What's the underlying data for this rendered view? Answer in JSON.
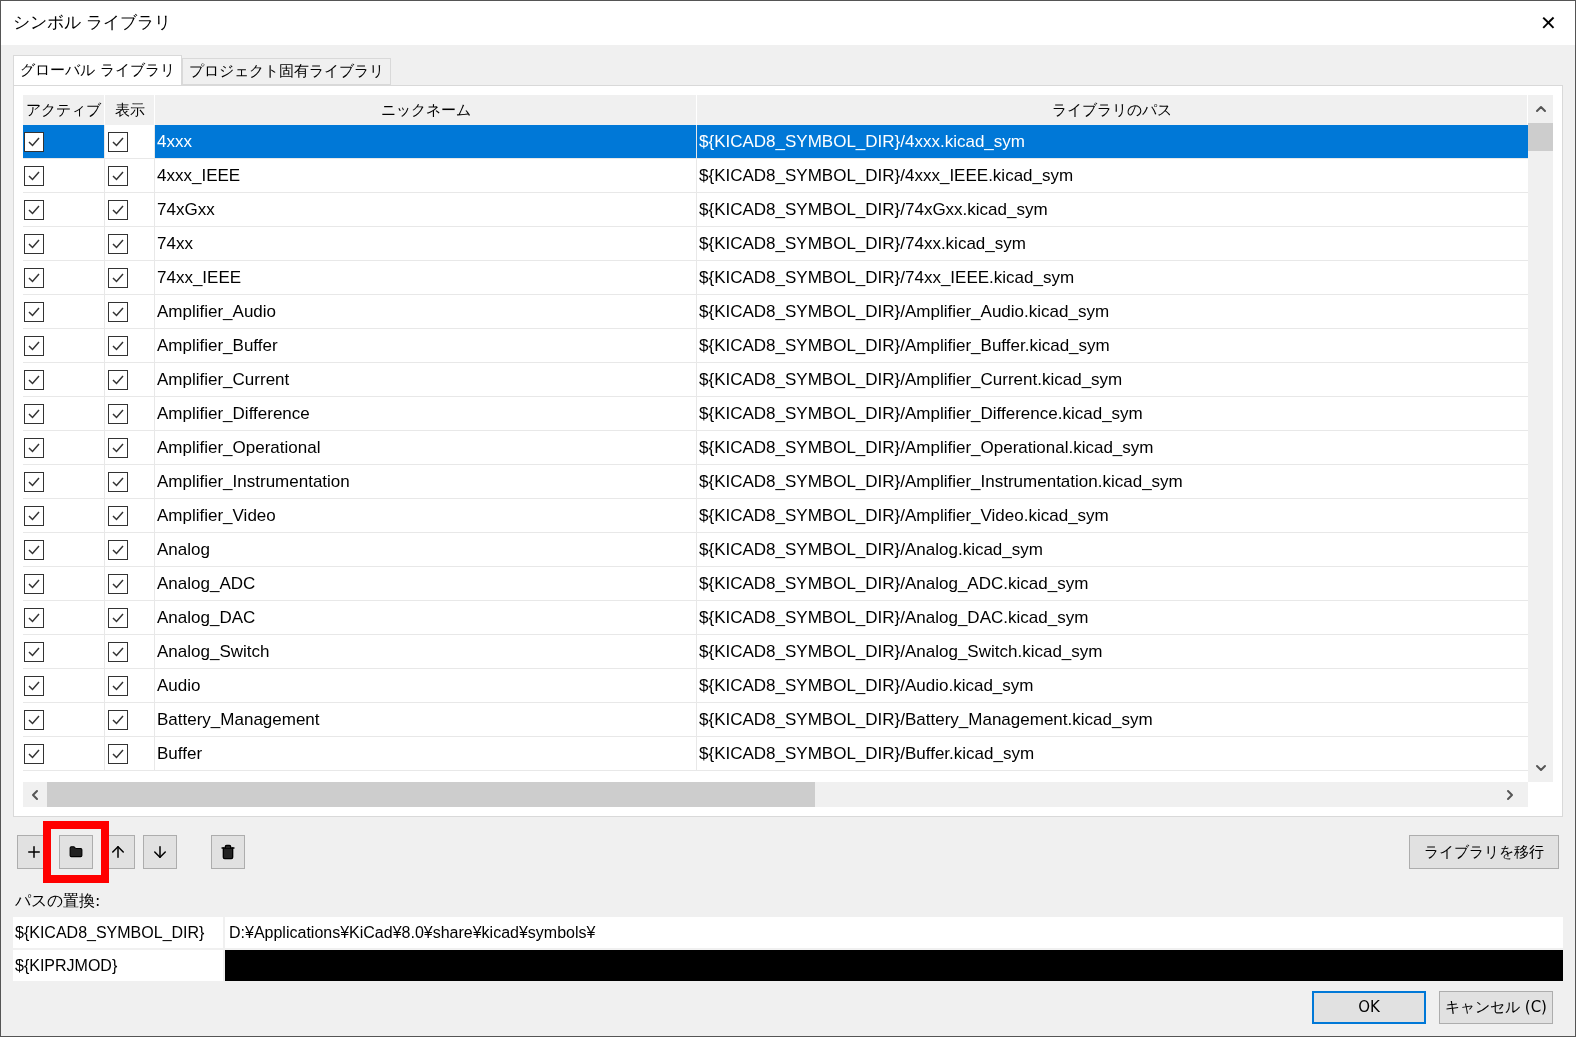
{
  "window": {
    "title": "シンボル ライブラリ",
    "close": "✕"
  },
  "tabs": [
    {
      "label": "グローバル ライブラリ",
      "selected": true
    },
    {
      "label": "プロジェクト固有ライブラリ",
      "selected": false
    }
  ],
  "table": {
    "columns": [
      "アクティブ",
      "表示",
      "ニックネーム",
      "ライブラリのパス"
    ],
    "rows": [
      {
        "active": true,
        "visible": true,
        "nickname": "4xxx",
        "path": "${KICAD8_SYMBOL_DIR}/4xxx.kicad_sym",
        "selected": true
      },
      {
        "active": true,
        "visible": true,
        "nickname": "4xxx_IEEE",
        "path": "${KICAD8_SYMBOL_DIR}/4xxx_IEEE.kicad_sym",
        "selected": false
      },
      {
        "active": true,
        "visible": true,
        "nickname": "74xGxx",
        "path": "${KICAD8_SYMBOL_DIR}/74xGxx.kicad_sym",
        "selected": false
      },
      {
        "active": true,
        "visible": true,
        "nickname": "74xx",
        "path": "${KICAD8_SYMBOL_DIR}/74xx.kicad_sym",
        "selected": false
      },
      {
        "active": true,
        "visible": true,
        "nickname": "74xx_IEEE",
        "path": "${KICAD8_SYMBOL_DIR}/74xx_IEEE.kicad_sym",
        "selected": false
      },
      {
        "active": true,
        "visible": true,
        "nickname": "Amplifier_Audio",
        "path": "${KICAD8_SYMBOL_DIR}/Amplifier_Audio.kicad_sym",
        "selected": false
      },
      {
        "active": true,
        "visible": true,
        "nickname": "Amplifier_Buffer",
        "path": "${KICAD8_SYMBOL_DIR}/Amplifier_Buffer.kicad_sym",
        "selected": false
      },
      {
        "active": true,
        "visible": true,
        "nickname": "Amplifier_Current",
        "path": "${KICAD8_SYMBOL_DIR}/Amplifier_Current.kicad_sym",
        "selected": false
      },
      {
        "active": true,
        "visible": true,
        "nickname": "Amplifier_Difference",
        "path": "${KICAD8_SYMBOL_DIR}/Amplifier_Difference.kicad_sym",
        "selected": false
      },
      {
        "active": true,
        "visible": true,
        "nickname": "Amplifier_Operational",
        "path": "${KICAD8_SYMBOL_DIR}/Amplifier_Operational.kicad_sym",
        "selected": false
      },
      {
        "active": true,
        "visible": true,
        "nickname": "Amplifier_Instrumentation",
        "path": "${KICAD8_SYMBOL_DIR}/Amplifier_Instrumentation.kicad_sym",
        "selected": false
      },
      {
        "active": true,
        "visible": true,
        "nickname": "Amplifier_Video",
        "path": "${KICAD8_SYMBOL_DIR}/Amplifier_Video.kicad_sym",
        "selected": false
      },
      {
        "active": true,
        "visible": true,
        "nickname": "Analog",
        "path": "${KICAD8_SYMBOL_DIR}/Analog.kicad_sym",
        "selected": false
      },
      {
        "active": true,
        "visible": true,
        "nickname": "Analog_ADC",
        "path": "${KICAD8_SYMBOL_DIR}/Analog_ADC.kicad_sym",
        "selected": false
      },
      {
        "active": true,
        "visible": true,
        "nickname": "Analog_DAC",
        "path": "${KICAD8_SYMBOL_DIR}/Analog_DAC.kicad_sym",
        "selected": false
      },
      {
        "active": true,
        "visible": true,
        "nickname": "Analog_Switch",
        "path": "${KICAD8_SYMBOL_DIR}/Analog_Switch.kicad_sym",
        "selected": false
      },
      {
        "active": true,
        "visible": true,
        "nickname": "Audio",
        "path": "${KICAD8_SYMBOL_DIR}/Audio.kicad_sym",
        "selected": false
      },
      {
        "active": true,
        "visible": true,
        "nickname": "Battery_Management",
        "path": "${KICAD8_SYMBOL_DIR}/Battery_Management.kicad_sym",
        "selected": false
      },
      {
        "active": true,
        "visible": true,
        "nickname": "Buffer",
        "path": "${KICAD8_SYMBOL_DIR}/Buffer.kicad_sym",
        "selected": false
      }
    ]
  },
  "migrate_button": "ライブラリを移行",
  "path_substitutions": {
    "label": "パスの置換:",
    "rows": [
      {
        "name": "${KICAD8_SYMBOL_DIR}",
        "value": "D:¥Applications¥KiCad¥8.0¥share¥kicad¥symbols¥",
        "redacted": false
      },
      {
        "name": "${KIPRJMOD}",
        "redacted": true
      }
    ]
  },
  "buttons": [
    {
      "label": "OK",
      "kind": "default"
    },
    {
      "label": "キャンセル (C)",
      "kind": "normal"
    }
  ]
}
